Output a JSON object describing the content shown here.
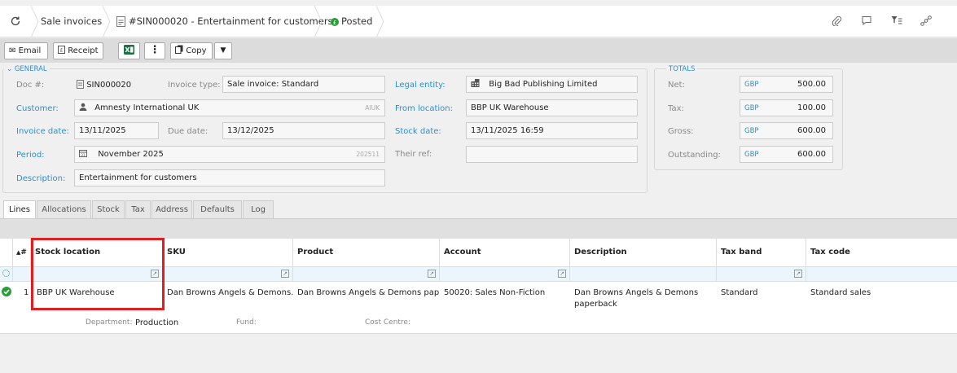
{
  "breadcrumb": {
    "refresh_icon": "refresh-icon",
    "module": "Sale invoices",
    "document": "#SIN000020 - Entertainment for customers",
    "status": "Posted"
  },
  "toolbar": {
    "email": "Email",
    "receipt": "Receipt",
    "copy": "Copy"
  },
  "general": {
    "legend": "GENERAL",
    "doc_label": "Doc #:",
    "doc_value": "SIN000020",
    "invoice_type_label": "Invoice type:",
    "invoice_type_value": "Sale invoice: Standard",
    "customer_label": "Customer:",
    "customer_value": "Amnesty International UK",
    "customer_code": "AIUK",
    "invoice_date_label": "Invoice date:",
    "invoice_date_value": "13/11/2025",
    "due_date_label": "Due date:",
    "due_date_value": "13/12/2025",
    "period_label": "Period:",
    "period_value": "November 2025",
    "period_code": "202511",
    "description_label": "Description:",
    "description_value": "Entertainment for customers",
    "legal_entity_label": "Legal entity:",
    "legal_entity_value": "Big Bad Publishing Limited",
    "from_location_label": "From location:",
    "from_location_value": "BBP UK Warehouse",
    "stock_date_label": "Stock date:",
    "stock_date_value": "13/11/2025 16:59",
    "their_ref_label": "Their ref:",
    "their_ref_value": ""
  },
  "totals": {
    "legend": "TOTALS",
    "currency": "GBP",
    "net_label": "Net:",
    "net_value": "500.00",
    "tax_label": "Tax:",
    "tax_value": "100.00",
    "gross_label": "Gross:",
    "gross_value": "600.00",
    "outstanding_label": "Outstanding:",
    "outstanding_value": "600.00"
  },
  "tabs": [
    "Lines",
    "Allocations",
    "Stock",
    "Tax",
    "Address",
    "Defaults",
    "Log"
  ],
  "grid": {
    "headers": {
      "num": "#",
      "stock_location": "Stock location",
      "sku": "SKU",
      "product": "Product",
      "account": "Account",
      "description": "Description",
      "tax_band": "Tax band",
      "tax_code": "Tax code"
    },
    "row": {
      "num": "1",
      "stock_location": "BBP UK Warehouse",
      "sku": "Dan Browns Angels & Demons...",
      "product": "Dan Browns Angels & Demons pap...",
      "account": "50020: Sales Non-Fiction",
      "description": "Dan Browns Angels & Demons paperback",
      "tax_band": "Standard",
      "tax_code": "Standard sales"
    },
    "detail": {
      "department_label": "Department:",
      "department_value": "Production",
      "fund_label": "Fund:",
      "cost_centre_label": "Cost Centre:"
    }
  },
  "colors": {
    "accent": "#2a8fd0",
    "highlight": "#e02020",
    "posted": "#2a9d3a"
  }
}
